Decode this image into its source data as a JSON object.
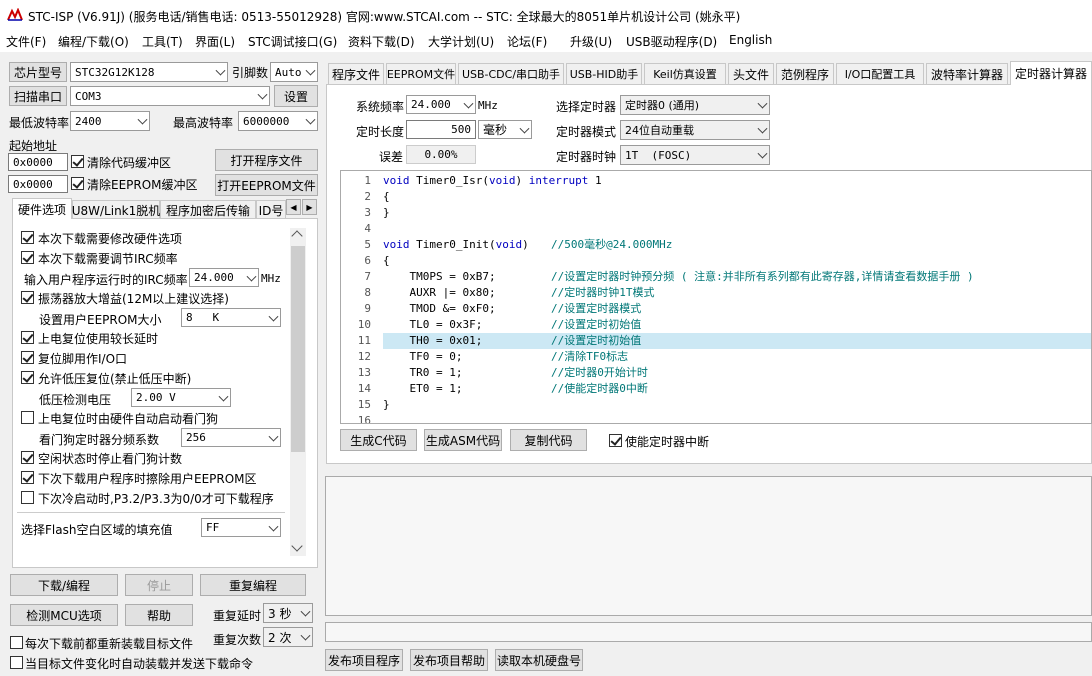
{
  "window": {
    "title": "STC-ISP (V6.91J) (服务电话/销售电话: 0513-55012928) 官网:www.STCAI.com  -- STC: 全球最大的8051单片机设计公司 (姚永平)"
  },
  "menu": [
    "文件(F)",
    "编程/下载(O)",
    "工具(T)",
    "界面(L)",
    "STC调试接口(G)",
    "资料下载(D)",
    "大学计划(U)",
    "论坛(F)",
    "升级(U)",
    "USB驱动程序(D)",
    "English"
  ],
  "left": {
    "chip_label": "芯片型号",
    "chip_value": "STC32G12K128",
    "pins_label": "引脚数",
    "pins_value": "Auto",
    "scan_button": "扫描串口",
    "port_value": "COM3",
    "settings_button": "设置",
    "min_baud_label": "最低波特率",
    "min_baud_value": "2400",
    "max_baud_label": "最高波特率",
    "max_baud_value": "6000000",
    "start_addr_label": "起始地址",
    "addr1": "0x0000",
    "clear_code": "清除代码缓冲区",
    "open_program": "打开程序文件",
    "addr2": "0x0000",
    "clear_eeprom": "清除EEPROM缓冲区",
    "open_eeprom": "打开EEPROM文件",
    "tabs": [
      "硬件选项",
      "U8W/Link1脱机",
      "程序加密后传输",
      "ID号"
    ],
    "options": {
      "o1": "本次下载需要修改硬件选项",
      "o2": "本次下载需要调节IRC频率",
      "irc_label": "输入用户程序运行时的IRC频率",
      "irc_value": "24.000",
      "irc_unit": "MHz",
      "o3": "振荡器放大增益(12M以上建议选择)",
      "eeprom_label": "设置用户EEPROM大小",
      "eeprom_value": "8   K",
      "o4": "上电复位使用较长延时",
      "o5": "复位脚用作I/O口",
      "o6": "允许低压复位(禁止低压中断)",
      "lv_label": "低压检测电压",
      "lv_value": "2.00 V",
      "o7": "上电复位时由硬件自动启动看门狗",
      "wdt_label": "看门狗定时器分频系数",
      "wdt_value": "256",
      "o8": "空闲状态时停止看门狗计数",
      "o9": "下次下载用户程序时擦除用户EEPROM区",
      "o10": "下次冷启动时,P3.2/P3.3为0/0才可下载程序",
      "fill_label": "选择Flash空白区域的填充值",
      "fill_value": "FF"
    },
    "download_button": "下载/编程",
    "stop_button": "停止",
    "reprogram_button": "重复编程",
    "detect_button": "检测MCU选项",
    "help_button": "帮助",
    "delay_label": "重复延时",
    "delay_value": "3 秒",
    "count_label": "重复次数",
    "count_value": "2 次",
    "reload_each": "每次下载前都重新装载目标文件",
    "auto_send": "当目标文件变化时自动装载并发送下载命令"
  },
  "right_tabs": [
    "程序文件",
    "EEPROM文件",
    "USB-CDC/串口助手",
    "USB-HID助手",
    "Keil仿真设置",
    "头文件",
    "范例程序",
    "I/O口配置工具",
    "波特率计算器",
    "定时器计算器"
  ],
  "timer": {
    "sysfreq_label": "系统频率",
    "sysfreq_value": "24.000",
    "sysfreq_unit": "MHz",
    "select_label": "选择定时器",
    "select_value": "定时器0 (通用)",
    "length_label": "定时长度",
    "length_value": "500",
    "length_unit": "毫秒",
    "mode_label": "定时器模式",
    "mode_value": "24位自动重载",
    "error_label": "误差",
    "error_value": "0.00%",
    "clock_label": "定时器时钟",
    "clock_value": "1T  (FOSC)",
    "code_lines": [
      {
        "n": "1",
        "code": "void Timer0_Isr(void) interrupt 1",
        "comment": ""
      },
      {
        "n": "2",
        "code": "{",
        "comment": ""
      },
      {
        "n": "3",
        "code": "}",
        "comment": ""
      },
      {
        "n": "4",
        "code": "",
        "comment": ""
      },
      {
        "n": "5",
        "code": "void Timer0_Init(void)",
        "comment": "//500毫秒@24.000MHz"
      },
      {
        "n": "6",
        "code": "{",
        "comment": ""
      },
      {
        "n": "7",
        "code": "    TM0PS = 0xB7;",
        "comment": "//设置定时器时钟预分频 ( 注意:并非所有系列都有此寄存器,详情请查看数据手册 )"
      },
      {
        "n": "8",
        "code": "    AUXR |= 0x80;",
        "comment": "//定时器时钟1T模式"
      },
      {
        "n": "9",
        "code": "    TMOD &= 0xF0;",
        "comment": "//设置定时器模式"
      },
      {
        "n": "10",
        "code": "    TL0 = 0x3F;",
        "comment": "//设置定时初始值"
      },
      {
        "n": "11",
        "code": "    TH0 = 0x01;",
        "comment": "//设置定时初始值"
      },
      {
        "n": "12",
        "code": "    TF0 = 0;",
        "comment": "//清除TF0标志"
      },
      {
        "n": "13",
        "code": "    TR0 = 1;",
        "comment": "//定时器0开始计时"
      },
      {
        "n": "14",
        "code": "    ET0 = 1;",
        "comment": "//使能定时器0中断"
      },
      {
        "n": "15",
        "code": "}",
        "comment": ""
      },
      {
        "n": "16",
        "code": "",
        "comment": ""
      }
    ],
    "gen_c": "生成C代码",
    "gen_asm": "生成ASM代码",
    "copy": "复制代码",
    "enable_int": "使能定时器中断"
  },
  "bottom": {
    "publish": "发布项目程序",
    "publish_help": "发布项目帮助",
    "read_disk": "读取本机硬盘号"
  }
}
